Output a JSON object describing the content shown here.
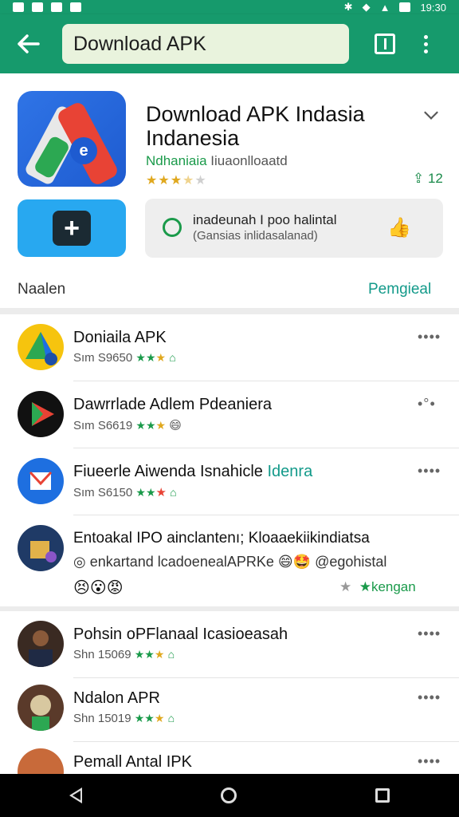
{
  "status_bar": {
    "time": "19:30"
  },
  "app_bar": {
    "search_value": "Download APK"
  },
  "hero": {
    "title": "Download APK Indasia Indanesia",
    "developer_primary": "Ndhaniaia",
    "developer_secondary": "Iiuaonlloaatd",
    "rating_stars": 3.5,
    "download_count": "12",
    "promo_line1": "inadeunah I poo halintal",
    "promo_line2": "(Gansias inlidasalanad)",
    "section_left": "Naalen",
    "section_right": "Pemgieal"
  },
  "colors": {
    "appbar": "#169a6c",
    "accent": "#139a8a",
    "star": "#e0a81e"
  },
  "list": [
    {
      "title": "Doniaila APK",
      "meta": "Sım S9650",
      "icon": "drive-icon"
    },
    {
      "title": "Dawrrlade Adlem Pdeaniera",
      "meta": "Sım S6619",
      "icon": "play-icon"
    },
    {
      "title": "Fiueerle Aiwenda Isnahicle",
      "title_highlight": "Idenra",
      "meta": "Sım S6150",
      "icon": "mail-icon"
    },
    {
      "title": "Entoakal IPO ainclantenı; Kloaaekiikindiatsa",
      "subtitle": "enkartand lcadoenealAPRKe",
      "subtitle2": "@egohistal",
      "tag": "★kengan",
      "icon": "box-icon"
    },
    {
      "title": "Pohsin oPFlanaal Icasioeasah",
      "meta": "Shn 15069",
      "icon": "person-icon"
    },
    {
      "title": "Ndalon APR",
      "meta": "Shn 15019",
      "icon": "bear-icon"
    },
    {
      "title": "Pemall Antal IPK",
      "meta": "",
      "icon": "person-icon"
    }
  ]
}
